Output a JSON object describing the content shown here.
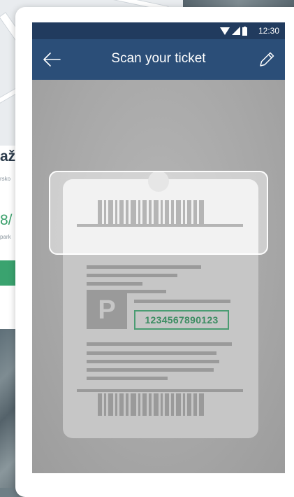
{
  "status_bar": {
    "time": "12:30",
    "icons": [
      "wifi-icon",
      "cell-signal-icon",
      "battery-icon"
    ]
  },
  "app_bar": {
    "title": "Scan your ticket",
    "back_icon": "arrow-left-icon",
    "edit_icon": "pencil-icon"
  },
  "ticket": {
    "parking_symbol": "P",
    "code": "1234567890123"
  },
  "background": {
    "heading_fragment": "až",
    "subtext_fragment": "rsko",
    "price_fragment": "8/",
    "price_subtext_fragment": "park"
  },
  "colors": {
    "status_bar": "#213b5e",
    "app_bar": "#2b4e78",
    "accent_green": "#3b8c61"
  }
}
